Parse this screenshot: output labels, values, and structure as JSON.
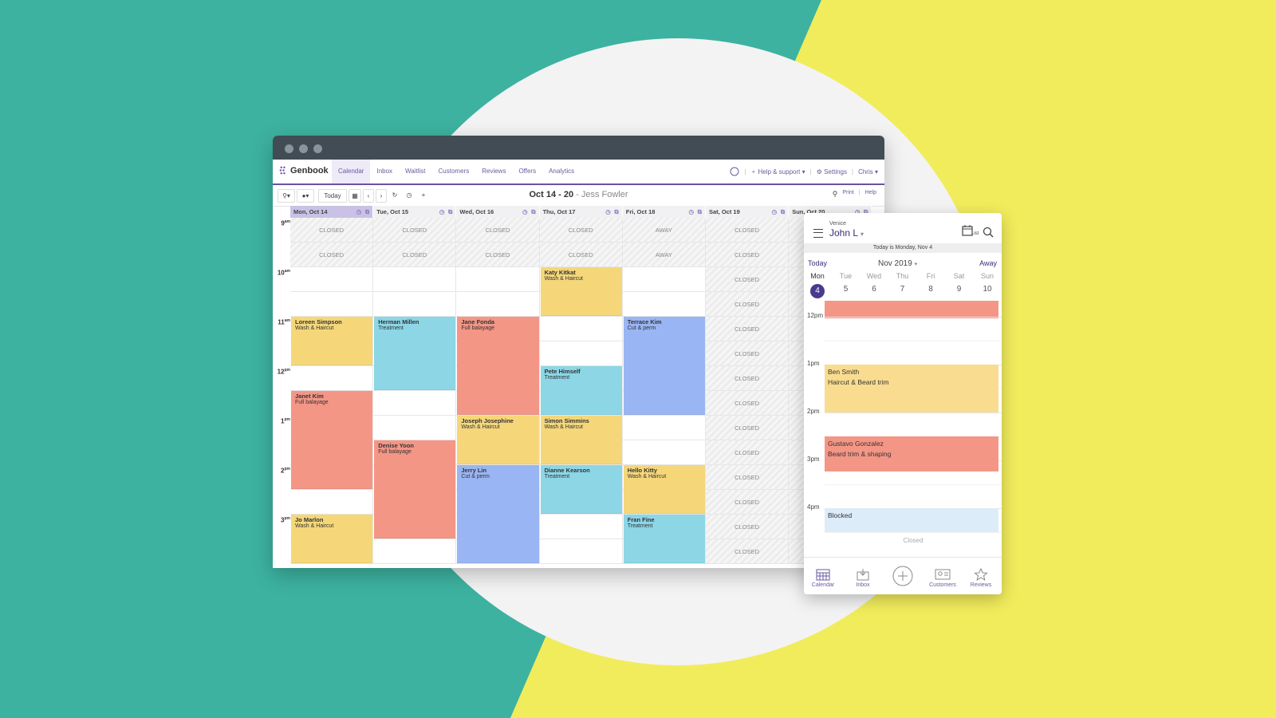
{
  "desktop": {
    "logo": "Genbook",
    "nav": [
      "Calendar",
      "Inbox",
      "Waitlist",
      "Customers",
      "Reviews",
      "Offers",
      "Analytics"
    ],
    "help": "Help & support",
    "settings": "Settings",
    "user": "Chris",
    "today_btn": "Today",
    "range": "Oct 14 - 20",
    "staff": "- Jess Fowler",
    "print": "Print",
    "help_short": "Help",
    "days": [
      "Mon, Oct 14",
      "Tue, Oct 15",
      "Wed, Oct 16",
      "Thu, Oct 17",
      "Fri, Oct 18",
      "Sat, Oct 19",
      "Sun, Oct 20"
    ],
    "hours": [
      "9",
      "10",
      "11",
      "12",
      "1",
      "2",
      "3"
    ],
    "hour_suffix": [
      "am",
      "am",
      "am",
      "pm",
      "pm",
      "pm",
      "pm"
    ],
    "closed": "CLOSED",
    "away": "AWAY",
    "appointments": [
      {
        "day": 3,
        "slot": 4,
        "len": 2,
        "name": "Katy Kitkat",
        "service": "Wash & Haircut",
        "color": "y"
      },
      {
        "day": 0,
        "slot": 6,
        "len": 2,
        "name": "Loreen Simpson",
        "service": "Wash & Haircut",
        "color": "y"
      },
      {
        "day": 1,
        "slot": 6,
        "len": 3,
        "name": "Herman Millen",
        "service": "Treatment",
        "color": "c"
      },
      {
        "day": 2,
        "slot": 6,
        "len": 4,
        "name": "Jane Fonda",
        "service": "Full balayage",
        "color": "r"
      },
      {
        "day": 4,
        "slot": 6,
        "len": 4,
        "name": "Terrace Kim",
        "service": "Cut & perm",
        "color": "b"
      },
      {
        "day": 3,
        "slot": 8,
        "len": 2,
        "name": "Pete Himself",
        "service": "Treatment",
        "color": "c"
      },
      {
        "day": 0,
        "slot": 9,
        "len": 4,
        "name": "Janet Kim",
        "service": "Full balayage",
        "color": "r"
      },
      {
        "day": 2,
        "slot": 10,
        "len": 2,
        "name": "Joseph Josephine",
        "service": "Wash & Haircut",
        "color": "y"
      },
      {
        "day": 3,
        "slot": 10,
        "len": 2,
        "name": "Simon Simmins",
        "service": "Wash & Haircut",
        "color": "y"
      },
      {
        "day": 1,
        "slot": 11,
        "len": 4,
        "name": "Denise Yoon",
        "service": "Full balayage",
        "color": "r"
      },
      {
        "day": 2,
        "slot": 12,
        "len": 4,
        "name": "Jerry Lin",
        "service": "Cut & perm",
        "color": "b"
      },
      {
        "day": 3,
        "slot": 12,
        "len": 2,
        "name": "Dianne Kearson",
        "service": "Treatment",
        "color": "c"
      },
      {
        "day": 4,
        "slot": 12,
        "len": 2,
        "name": "Hello Kitty",
        "service": "Wash & Haircut",
        "color": "y"
      },
      {
        "day": 0,
        "slot": 14,
        "len": 2,
        "name": "Jo Marlon",
        "service": "Wash & Haircut",
        "color": "y"
      },
      {
        "day": 4,
        "slot": 14,
        "len": 2,
        "name": "Fran Fine",
        "service": "Treatment",
        "color": "c"
      }
    ]
  },
  "mobile": {
    "location": "Venice",
    "user": "John L",
    "list_label": "List",
    "today_banner": "Today is Monday, Nov 4",
    "today_btn": "Today",
    "month": "Nov 2019",
    "away": "Away",
    "week_days": [
      "Mon",
      "Tue",
      "Wed",
      "Thu",
      "Fri",
      "Sat",
      "Sun"
    ],
    "week_dates": [
      "4",
      "5",
      "6",
      "7",
      "8",
      "9",
      "10"
    ],
    "times": [
      "12pm",
      "1pm",
      "2pm",
      "3pm",
      "4pm"
    ],
    "appointments": [
      {
        "name": "Ben Smith",
        "service": "Haircut & Beard trim",
        "color": "#f9dc8f"
      },
      {
        "name": "Gustavo Gonzalez",
        "service": "Beard trim & shaping",
        "color": "#f49686"
      },
      {
        "name": "Blocked",
        "service": "",
        "color": "#dcecf9"
      }
    ],
    "closed": "Closed",
    "tabs": [
      "Calendar",
      "Inbox",
      "Customers",
      "Reviews"
    ]
  }
}
